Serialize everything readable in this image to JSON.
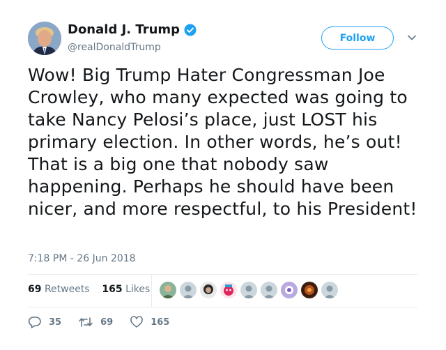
{
  "author": {
    "name": "Donald J. Trump",
    "handle": "@realDonaldTrump",
    "verified_icon": "verified-badge-icon"
  },
  "follow_button_label": "Follow",
  "tweet": {
    "text": "Wow! Big Trump Hater Congressman Joe Crowley, who many expected was going to take Nancy Pelosi’s place, just LOST his primary election. In other words, he’s out! That is a big one that nobody saw happening. Perhaps he should have been nicer, and more respectful, to his President!",
    "timestamp": "7:18 PM - 26 Jun 2018"
  },
  "stats": {
    "retweets_count": "69",
    "retweets_label": "Retweets",
    "likes_count": "165",
    "likes_label": "Likes"
  },
  "actions": {
    "replies": "35",
    "retweets": "69",
    "likes": "165"
  },
  "colors": {
    "accent": "#1da1f2",
    "text": "#14171a",
    "muted": "#657786",
    "divider": "#e6ecf0"
  }
}
